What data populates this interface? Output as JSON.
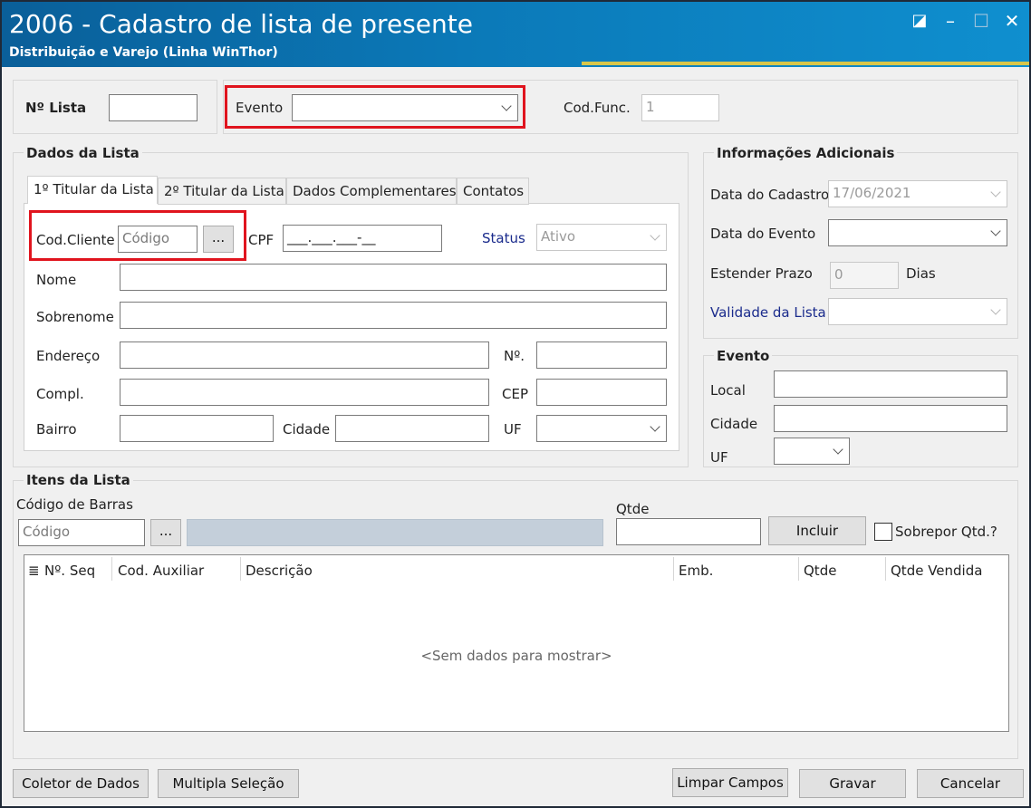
{
  "window": {
    "title": "2006 - Cadastro de lista de presente",
    "subtitle": "Distribuição e Varejo (Linha WinThor)",
    "buttons": {
      "restore_icon": "◪",
      "minimize": "–",
      "maximize": "☐",
      "close": "✕"
    }
  },
  "header": {
    "lista_label": "Nº Lista",
    "lista_value": "",
    "evento_label": "Evento",
    "evento_value": "",
    "codfunc_label": "Cod.Func.",
    "codfunc_value": "1"
  },
  "dados_lista": {
    "title": "Dados da Lista",
    "tabs": [
      "1º Titular da Lista",
      "2º Titular da Lista",
      "Dados Complementares",
      "Contatos"
    ],
    "cod_cliente_label": "Cod.Cliente",
    "cod_cliente_placeholder": "Código",
    "lookup_button": "...",
    "cpf_label": "CPF",
    "cpf_mask": "___.___.___-__",
    "status_label": "Status",
    "status_value": "Ativo",
    "nome_label": "Nome",
    "sobrenome_label": "Sobrenome",
    "endereco_label": "Endereço",
    "numero_label": "Nº.",
    "compl_label": "Compl.",
    "cep_label": "CEP",
    "bairro_label": "Bairro",
    "cidade_label": "Cidade",
    "uf_label": "UF"
  },
  "info_adicionais": {
    "title": "Informações Adicionais",
    "data_cadastro_label": "Data do Cadastro",
    "data_cadastro_value": "17/06/2021",
    "data_evento_label": "Data do Evento",
    "data_evento_value": "",
    "estender_prazo_label": "Estender Prazo",
    "estender_prazo_value": "0",
    "dias_label": "Dias",
    "validade_label": "Validade da Lista",
    "validade_value": ""
  },
  "evento": {
    "title": "Evento",
    "local_label": "Local",
    "cidade_label": "Cidade",
    "uf_label": "UF"
  },
  "itens": {
    "title": "Itens da Lista",
    "codigo_barras_label": "Código de Barras",
    "codigo_placeholder": "Código",
    "lookup_button": "...",
    "qtde_label": "Qtde",
    "incluir_button": "Incluir",
    "sobrepor_label": "Sobrepor Qtd.?",
    "sobrepor_checked": false,
    "grid_icon": "≣",
    "columns": [
      "Nº. Seq",
      "Cod. Auxiliar",
      "Descrição",
      "Emb.",
      "Qtde",
      "Qtde Vendida"
    ],
    "empty_text": "<Sem dados para mostrar>"
  },
  "footer": {
    "coletor": "Coletor de Dados",
    "multipla": "Multipla Seleção",
    "limpar": "Limpar Campos",
    "gravar": "Gravar",
    "cancelar": "Cancelar"
  },
  "colors": {
    "titlebar": "#0b79b8",
    "highlight": "#e0141e",
    "accent_line": "#d8c64a",
    "label_blue": "#1a2b8c"
  }
}
